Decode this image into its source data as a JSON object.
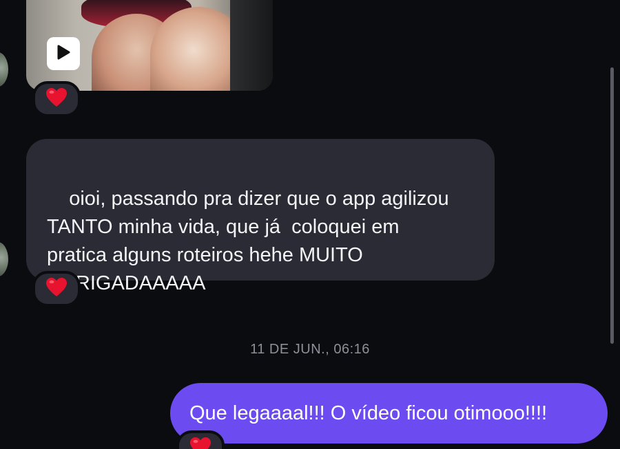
{
  "thread": {
    "media_message": {
      "kind": "video",
      "reaction": "❤️"
    },
    "incoming_message": {
      "text": "oioi, passando pra dizer que o app agilizou\nTANTO minha vida, que já  coloquei em\npratica alguns roteiros hehe MUITO\nOBRIGADAAAAA",
      "reaction": "❤️"
    },
    "date_divider": "11 DE JUN., 06:16",
    "outgoing_message": {
      "text": "Que legaaaal!!! O vídeo ficou otimooo!!!!",
      "reaction": "❤️"
    }
  },
  "icons": {
    "play": "play-icon",
    "reaction": "heart-icon",
    "avatar": "avatar"
  },
  "colors": {
    "background": "#0b0c10",
    "incoming_bubble": "#2a2b34",
    "outgoing_bubble": "#6c4cf1",
    "timestamp": "#8e8f99",
    "heart": "#e8132e"
  }
}
